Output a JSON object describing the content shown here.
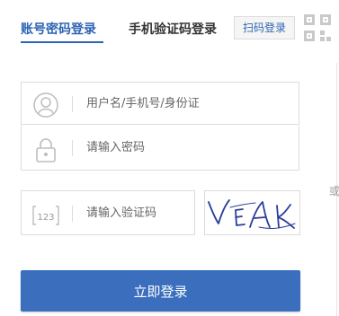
{
  "tabs": {
    "account_login": "账号密码登录",
    "mobile_login": "手机验证码登录",
    "qr_login": "扫码登录"
  },
  "form": {
    "username_placeholder": "用户名/手机号/身份证",
    "password_placeholder": "请输入密码",
    "captcha_placeholder": "请输入验证码",
    "captcha_text": "VEAK"
  },
  "or_label": "或",
  "login_button": "立即登录",
  "icons": [
    "qr-code-icon",
    "user-icon",
    "lock-icon",
    "captcha-icon"
  ],
  "colors": {
    "accent": "#2d64b3",
    "button": "#3b6fbd",
    "border": "#dcdcdc",
    "captcha_ink": "#2a3d9a"
  }
}
